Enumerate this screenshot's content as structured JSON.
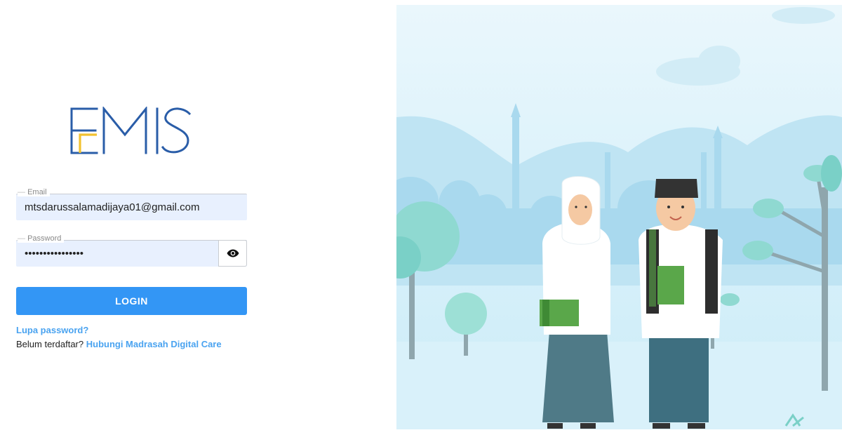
{
  "brand": {
    "logo_text": "EMIS",
    "logo_color": "#2a5da8",
    "logo_accent": "#f2c230"
  },
  "form": {
    "email": {
      "label": "Email",
      "value": "mtsdarussalamadijaya01@gmail.com"
    },
    "password": {
      "label": "Password",
      "value": "••••••••••••••••"
    },
    "toggle_icon": "eye-icon",
    "login_label": "LOGIN"
  },
  "links": {
    "forgot_password": "Lupa password?",
    "signup_prefix": "Belum terdaftar?",
    "signup_link": "Hubungi Madrasah Digital Care"
  },
  "colors": {
    "primary": "#3396f5",
    "link": "#4aa3f0",
    "input_bg": "#e8f0fe",
    "sky": "#e0f3fb"
  }
}
